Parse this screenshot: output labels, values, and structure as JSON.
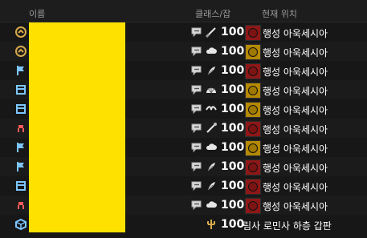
{
  "header": {
    "name_label": "이름",
    "class_label": "클래스/잡",
    "location_label": "현재 위치"
  },
  "rows": [
    {
      "status_icon": "sun-icon",
      "chat_icon": "speech-bubble-icon",
      "job_icon": "sword-icon",
      "level": "100",
      "crest_color": "#8e1717",
      "location": "행성 아욱세시아"
    },
    {
      "status_icon": "sun-icon",
      "chat_icon": "speech-bubble-icon",
      "job_icon": "cloud-icon",
      "level": "100",
      "crest_color": "#b58900",
      "location": "행성 아욱세시아"
    },
    {
      "status_icon": "flag-icon",
      "chat_icon": "speech-bubble-icon",
      "job_icon": "feather-icon",
      "level": "100",
      "crest_color": "#8e1717",
      "location": "행성 아욱세시아"
    },
    {
      "status_icon": "book-icon",
      "chat_icon": "speech-bubble-icon",
      "job_icon": "fan-icon",
      "level": "100",
      "crest_color": "#b58900",
      "location": "행성 아욱세시아"
    },
    {
      "status_icon": "book-icon",
      "chat_icon": "speech-bubble-icon",
      "job_icon": "wings-icon",
      "level": "100",
      "crest_color": "#b58900",
      "location": "행성 아욱세시아"
    },
    {
      "status_icon": "chair-icon",
      "chat_icon": "speech-bubble-icon",
      "job_icon": "staff-icon",
      "level": "100",
      "crest_color": "#8e1717",
      "location": "행성 아욱세시아"
    },
    {
      "status_icon": "flag-icon",
      "chat_icon": "speech-bubble-icon",
      "job_icon": "cloud-icon",
      "level": "100",
      "crest_color": "#b58900",
      "location": "행성 아욱세시아"
    },
    {
      "status_icon": "flag-icon",
      "chat_icon": "speech-bubble-icon",
      "job_icon": "feather-icon",
      "level": "100",
      "crest_color": "#8e1717",
      "location": "행성 아욱세시아"
    },
    {
      "status_icon": "book-icon",
      "chat_icon": "speech-bubble-icon",
      "job_icon": "feather-icon",
      "level": "100",
      "crest_color": "#8e1717",
      "location": "행성 아욱세시아"
    },
    {
      "status_icon": "chair-icon",
      "chat_icon": "speech-bubble-icon",
      "job_icon": "cloud-icon",
      "level": "100",
      "crest_color": "#8e1717",
      "location": "행성 아욱세시아"
    },
    {
      "status_icon": "cube-icon",
      "chat_icon": "",
      "job_icon": "trident-icon",
      "level": "100",
      "crest_color": "",
      "location": "림사 로민사 하층 갑판"
    }
  ],
  "colors": {
    "redact_yellow": "#ffe100"
  }
}
